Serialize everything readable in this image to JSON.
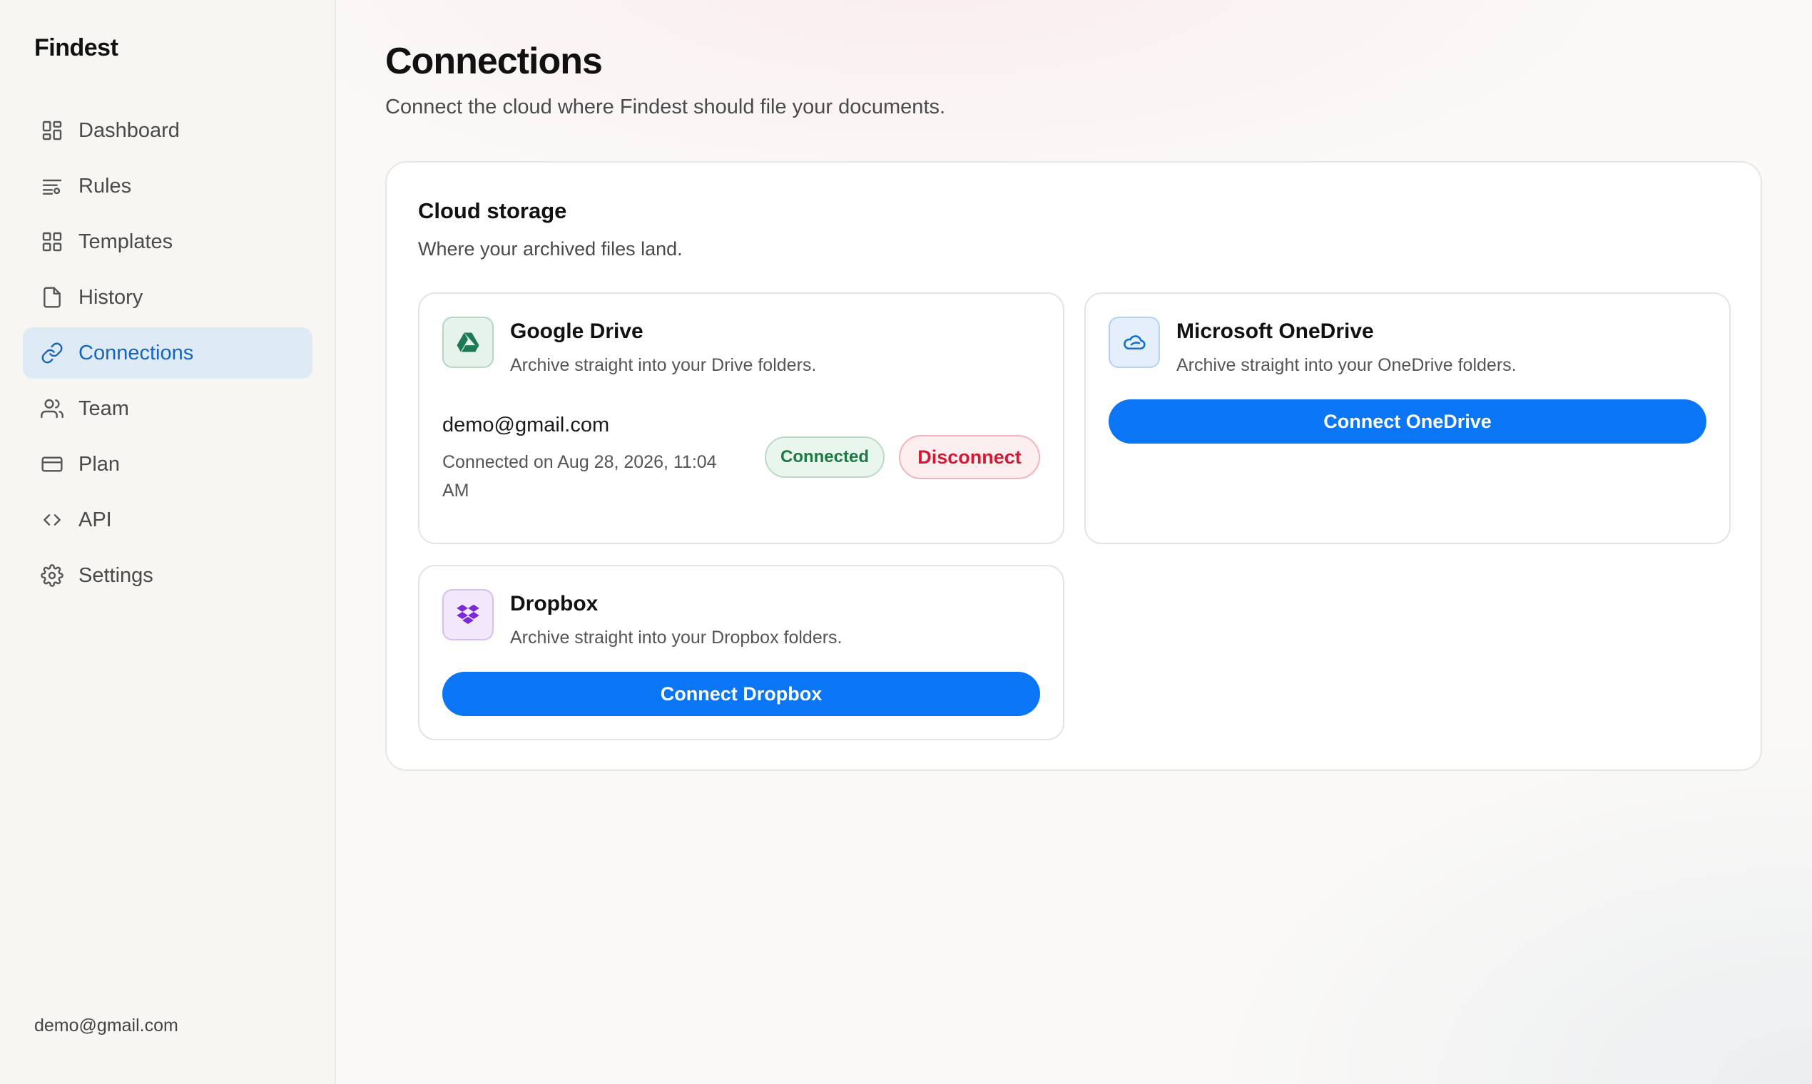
{
  "app": {
    "brand": "Findest"
  },
  "sidebar": {
    "items": [
      {
        "label": "Dashboard",
        "icon": "dashboard-icon"
      },
      {
        "label": "Rules",
        "icon": "rules-icon"
      },
      {
        "label": "Templates",
        "icon": "templates-icon"
      },
      {
        "label": "History",
        "icon": "document-icon"
      },
      {
        "label": "Connections",
        "icon": "link-icon",
        "active": true
      },
      {
        "label": "Team",
        "icon": "users-icon"
      },
      {
        "label": "Plan",
        "icon": "credit-card-icon"
      },
      {
        "label": "API",
        "icon": "code-icon"
      },
      {
        "label": "Settings",
        "icon": "gear-icon"
      }
    ],
    "footer_email": "demo@gmail.com"
  },
  "page": {
    "title": "Connections",
    "subtitle": "Connect the cloud where Findest should file your documents."
  },
  "cloud_storage": {
    "title": "Cloud storage",
    "subtitle": "Where your archived files land.",
    "providers": [
      {
        "name": "Google Drive",
        "description": "Archive straight into your Drive folders.",
        "icon": "google-drive-icon",
        "account_email": "demo@gmail.com",
        "connected_on": "Connected on Aug 28, 2026, 11:04 AM",
        "status": "Connected",
        "action": "Disconnect"
      },
      {
        "name": "Microsoft OneDrive",
        "description": "Archive straight into your OneDrive folders.",
        "icon": "onedrive-icon",
        "action": "Connect OneDrive"
      },
      {
        "name": "Dropbox",
        "description": "Archive straight into your Dropbox folders.",
        "icon": "dropbox-icon",
        "action": "Connect Dropbox"
      }
    ]
  },
  "colors": {
    "accent": "#0b76f5",
    "active_nav_bg": "#deeaf5",
    "active_nav_text": "#1565c0",
    "connected_green": "#1e7a45",
    "disconnect_red": "#d21a34",
    "google_drive": "#1e7a55",
    "onedrive": "#0b6fd6",
    "dropbox": "#7b2bd6"
  }
}
